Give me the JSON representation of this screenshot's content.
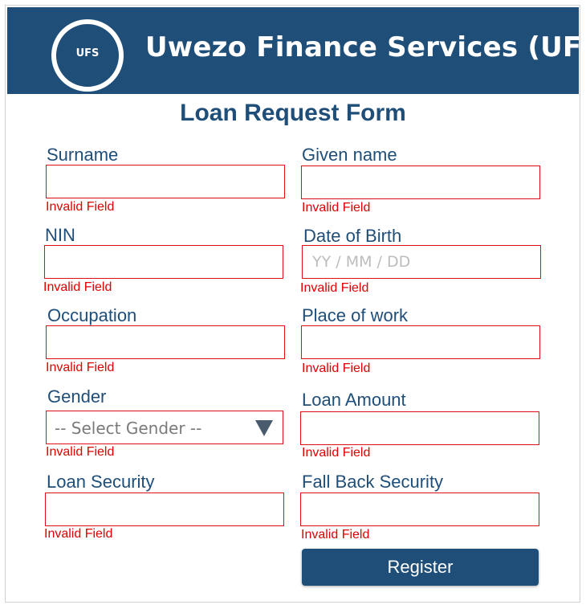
{
  "header": {
    "logo_text": "UFS",
    "title": "Uwezo Finance Services (UFS)"
  },
  "form": {
    "title": "Loan Request Form",
    "error_text": "Invalid Field",
    "surname": {
      "label": "Surname",
      "value": ""
    },
    "given_name": {
      "label": "Given name",
      "value": ""
    },
    "nin": {
      "label": "NIN",
      "value": ""
    },
    "dob": {
      "label": "Date of Birth",
      "placeholder": "YY / MM / DD"
    },
    "occupation": {
      "label": "Occupation",
      "value": ""
    },
    "place_of_work": {
      "label": "Place of work",
      "value": ""
    },
    "gender": {
      "label": "Gender",
      "selected": "-- Select Gender --"
    },
    "loan_amount": {
      "label": "Loan Amount",
      "value": ""
    },
    "loan_security": {
      "label": "Loan Security",
      "value": ""
    },
    "fallback_security": {
      "label": "Fall Back Security",
      "value": ""
    },
    "register_label": "Register"
  },
  "colors": {
    "brand": "#1f4e79",
    "error": "#e00000",
    "field_border": "#e0101a"
  },
  "icons": {
    "gender_dropdown": "triangle-down-icon"
  }
}
